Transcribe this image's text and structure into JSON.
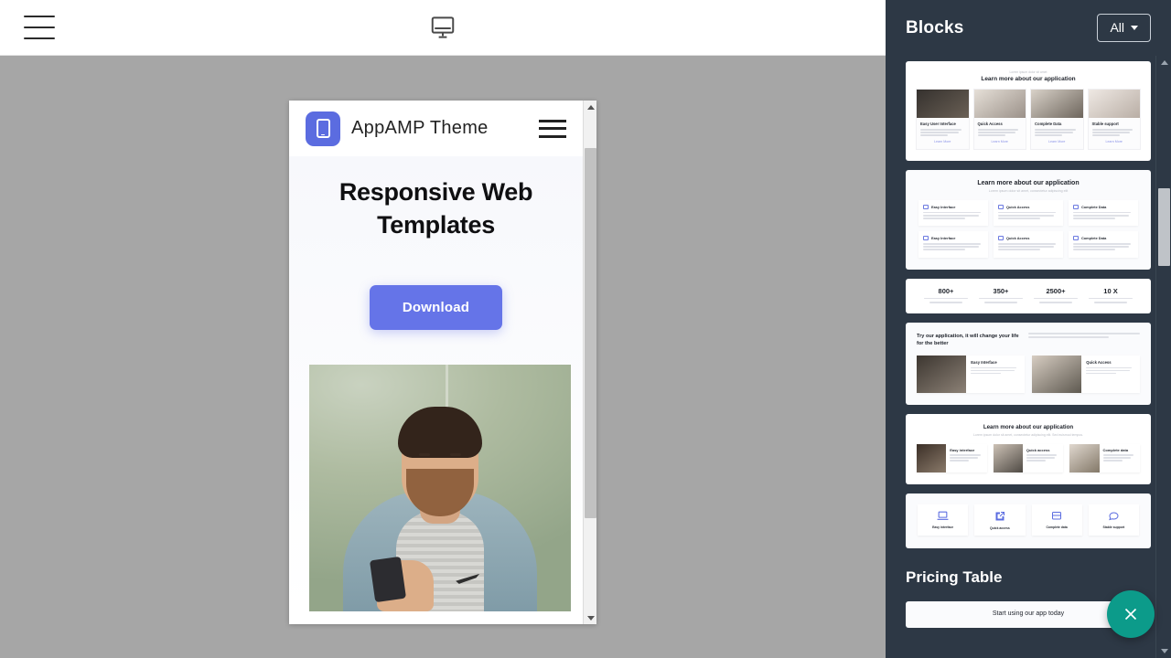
{
  "topbar": {
    "menu_icon": "hamburger-menu-icon",
    "device_icon": "desktop-monitor-icon"
  },
  "preview": {
    "brand": "AppAMP Theme",
    "logo_icon": "mobile-phone-icon",
    "nav_menu_icon": "hamburger-menu-icon",
    "hero_heading": "Responsive Web Templates",
    "download_label": "Download",
    "photo_alt": "man in denim shirt looking at smartphone",
    "accent_color": "#6574e8",
    "scrollbar": {
      "up_icon": "chevron-up-icon",
      "down_icon": "chevron-down-icon"
    }
  },
  "panel": {
    "title": "Blocks",
    "filter_label": "All",
    "filter_caret_icon": "caret-down-icon",
    "bg_color": "#2d3845",
    "scrollbar": {
      "up_icon": "chevron-up-icon",
      "down_icon": "chevron-down-icon"
    },
    "sections": [
      {
        "label": "Pricing Table"
      }
    ],
    "blocks": [
      {
        "id": "features-image-cards",
        "eyebrow": "Lorem ipsum dolor sit amet",
        "heading": "Learn more about our application",
        "cards": [
          {
            "title": "Easy User Interface",
            "link": "Learn More"
          },
          {
            "title": "Quick Access",
            "link": "Learn More"
          },
          {
            "title": "Complete Data",
            "link": "Learn More"
          },
          {
            "title": "Stable support",
            "link": "Learn More"
          }
        ]
      },
      {
        "id": "features-icon-grid",
        "heading": "Learn more about our application",
        "subheading": "Lorem ipsum dolor sit amet, consectetur adipiscing elit",
        "cards": [
          {
            "title": "Easy Interface",
            "icon": "laptop-icon"
          },
          {
            "title": "Quick Access",
            "icon": "external-link-icon"
          },
          {
            "title": "Complete Data",
            "icon": "database-icon"
          },
          {
            "title": "Easy Interface",
            "icon": "laptop-icon"
          },
          {
            "title": "Quick Access",
            "icon": "external-link-icon"
          },
          {
            "title": "Complete Data",
            "icon": "database-icon"
          }
        ]
      },
      {
        "id": "counters",
        "counters": [
          {
            "value": "800+"
          },
          {
            "value": "350+"
          },
          {
            "value": "2500+"
          },
          {
            "value": "10 X"
          }
        ]
      },
      {
        "id": "try-our-application",
        "heading": "Try our application, it will change your life for the better",
        "cards": [
          {
            "title": "Easy Interface"
          },
          {
            "title": "Quick Access"
          }
        ]
      },
      {
        "id": "learn-more-three-cards",
        "heading": "Learn more about our application",
        "subheading": "Lorem ipsum dolor sit amet, consectetur adipiscing elit. Sed euismod tempus.",
        "cards": [
          {
            "title": "Easy interface"
          },
          {
            "title": "Quick access"
          },
          {
            "title": "Complete data"
          }
        ]
      },
      {
        "id": "icon-tiles",
        "cards": [
          {
            "title": "Easy interface",
            "icon": "laptop-icon"
          },
          {
            "title": "Quick access",
            "icon": "external-link-icon"
          },
          {
            "title": "Complete data",
            "icon": "database-icon"
          },
          {
            "title": "Stable support",
            "icon": "chat-bubble-icon"
          }
        ]
      },
      {
        "id": "pricing-start",
        "heading": "Start using our app today"
      }
    ]
  },
  "fab": {
    "icon": "close-x-icon",
    "color": "#0c9b8a"
  }
}
